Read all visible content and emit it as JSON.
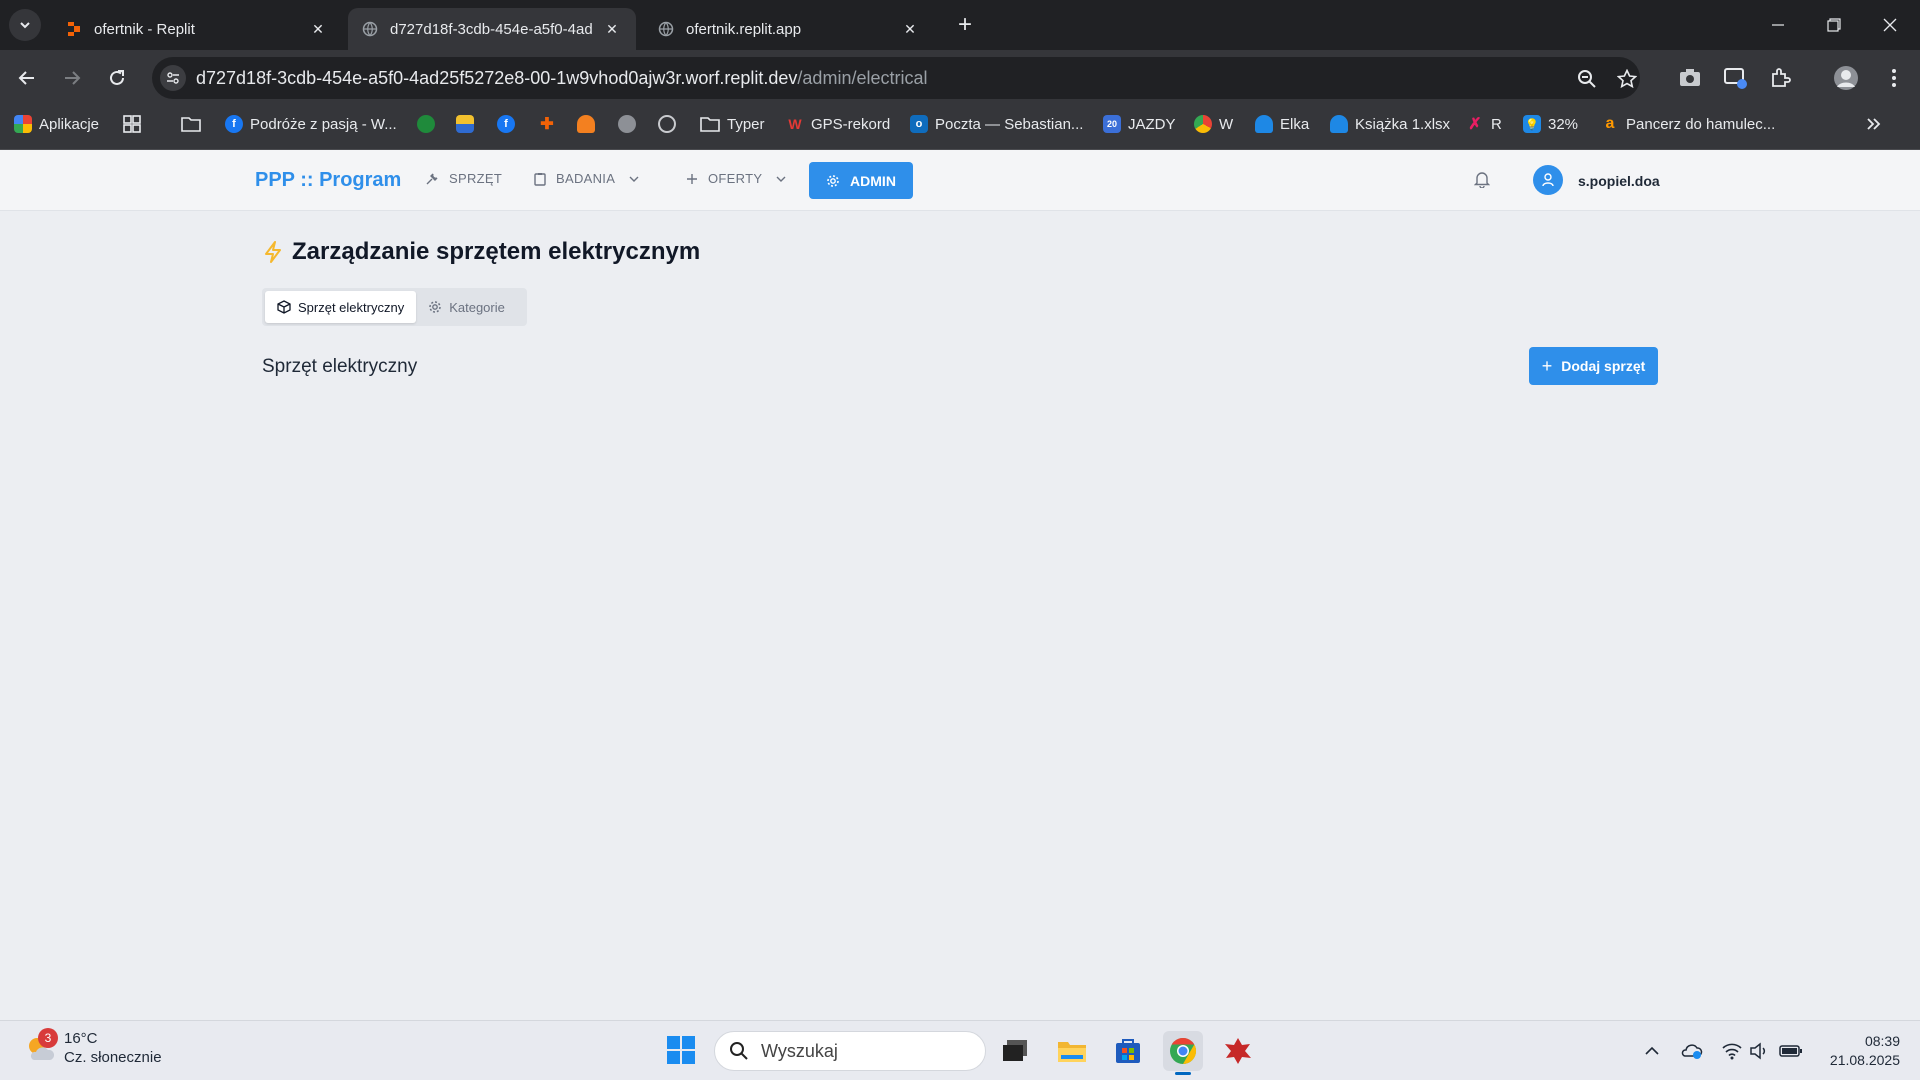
{
  "browser": {
    "tabs": [
      {
        "title": "ofertnik - Replit",
        "icon": "replit-favicon",
        "active": false
      },
      {
        "title": "d727d18f-3cdb-454e-a5f0-4ad",
        "icon": "globe-icon",
        "active": true
      },
      {
        "title": "ofertnik.replit.app",
        "icon": "globe-icon",
        "active": false
      }
    ],
    "url_host": "d727d18f-3cdb-454e-a5f0-4ad25f5272e8-00-1w9vhod0ajw3r.worf.replit.dev",
    "url_path": "/admin/electrical",
    "bookmarks": [
      {
        "label": "Aplikacje",
        "icon": "apps-grid-icon"
      },
      {
        "label": "Podróże z pasją - W...",
        "icon": "facebook-icon"
      },
      {
        "label": "Typer",
        "icon": "folder-icon"
      },
      {
        "label": "GPS-rekord",
        "icon": "gps-icon"
      },
      {
        "label": "Poczta — Sebastian...",
        "icon": "outlook-icon"
      },
      {
        "label": "JAZDY",
        "icon": "calendar-icon"
      },
      {
        "label": "W",
        "icon": "chrome-icon"
      },
      {
        "label": "Elka",
        "icon": "onedrive-icon"
      },
      {
        "label": "Książka 1.xlsx",
        "icon": "onedrive-icon"
      },
      {
        "label": "R",
        "icon": "r-icon"
      },
      {
        "label": "32%",
        "icon": "bulb-icon"
      },
      {
        "label": "Pancerz do hamulec...",
        "icon": "amazon-icon"
      }
    ]
  },
  "app": {
    "brand": "PPP :: Program",
    "nav": {
      "equipment": "SPRZĘT",
      "research": "BADANIA",
      "offers": "OFERTY",
      "admin": "ADMIN"
    },
    "username": "s.popiel.doa",
    "page_title": "Zarządzanie sprzętem elektrycznym",
    "tabs": {
      "electrical": "Sprzęt elektryczny",
      "categories": "Kategorie"
    },
    "section_title": "Sprzęt elektryczny",
    "add_button": "Dodaj sprzęt",
    "accent_color": "#2f8fea"
  },
  "taskbar": {
    "weather_temp": "16°C",
    "weather_desc": "Cz. słonecznie",
    "weather_badge": "3",
    "search_placeholder": "Wyszukaj",
    "time": "08:39",
    "date": "21.08.2025"
  }
}
